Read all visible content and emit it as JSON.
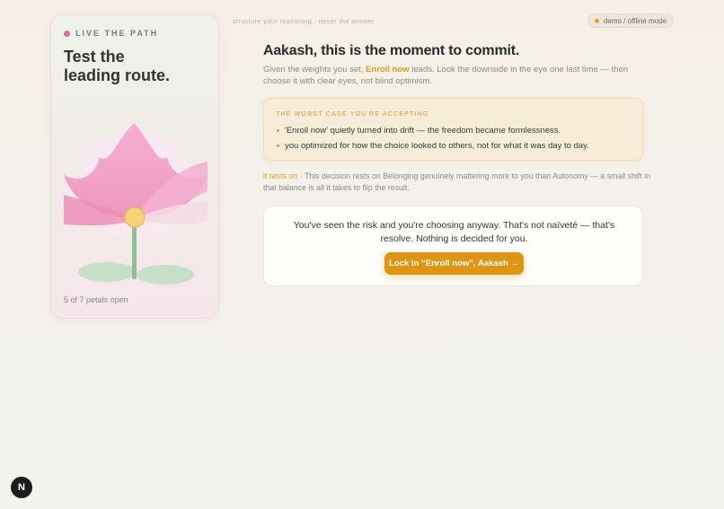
{
  "tagline": "structure your reasoning · never the answer",
  "mode": {
    "label": "demo / offline mode",
    "dot_color": "#e0a02a"
  },
  "card": {
    "tag": "LIVE THE PATH",
    "title_line1": "Test the",
    "title_line2": "leading route.",
    "petal_status": "5 of 7 petals open",
    "petals_open": 5,
    "petals_total": 7
  },
  "main": {
    "headline": "Aakash, this is the moment to commit.",
    "sub_prefix": "Given the weights you set, ",
    "sub_highlight": "Enroll now",
    "sub_suffix": " leads. Look the downside in the eye one last time — then choose it with clear eyes, not blind optimism.",
    "worst_case": {
      "title": "THE WORST CASE YOU'RE ACCEPTING",
      "items": [
        "'Enroll now' quietly turned into drift — the freedom became formlessness.",
        "you optimized for how the choice looked to others, not for what it was day to day."
      ]
    },
    "rests_label": "it rests on",
    "rests_text": " · This decision rests on Belonging genuinely mattering more to you than Autonomy — a small shift in that balance is all it takes to flip the result.",
    "commit": {
      "text": "You've seen the risk and you're choosing anyway. That's not naïveté — that's resolve. Nothing is decided for you.",
      "button_label": "Lock in “Enroll now”, Aakash →"
    }
  },
  "badge": {
    "letter": "N"
  },
  "colors": {
    "accent": "#df9514",
    "pink": "#d86fa0"
  },
  "icons": {
    "mode": "status-dot-icon",
    "flower": "lotus-flower-icon",
    "badge": "next-n-icon"
  }
}
